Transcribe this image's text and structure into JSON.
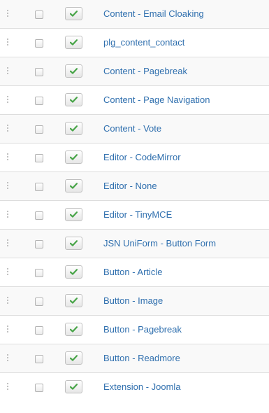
{
  "plugins": [
    {
      "name": "Content - Email Cloaking",
      "enabled": true
    },
    {
      "name": "plg_content_contact",
      "enabled": true
    },
    {
      "name": "Content - Pagebreak",
      "enabled": true
    },
    {
      "name": "Content - Page Navigation",
      "enabled": true
    },
    {
      "name": "Content - Vote",
      "enabled": true
    },
    {
      "name": "Editor - CodeMirror",
      "enabled": true
    },
    {
      "name": "Editor - None",
      "enabled": true
    },
    {
      "name": "Editor - TinyMCE",
      "enabled": true
    },
    {
      "name": "JSN UniForm - Button Form",
      "enabled": true
    },
    {
      "name": "Button - Article",
      "enabled": true
    },
    {
      "name": "Button - Image",
      "enabled": true
    },
    {
      "name": "Button - Pagebreak",
      "enabled": true
    },
    {
      "name": "Button - Readmore",
      "enabled": true
    },
    {
      "name": "Extension - Joomla",
      "enabled": true
    }
  ],
  "icons": {
    "drag": "drag-handle-icon",
    "checkbox": "checkbox-icon",
    "enabled": "check-icon"
  },
  "colors": {
    "link": "#2f6fae",
    "check": "#47a447",
    "stripe": "#f9f9f9",
    "border": "#dddddd"
  }
}
